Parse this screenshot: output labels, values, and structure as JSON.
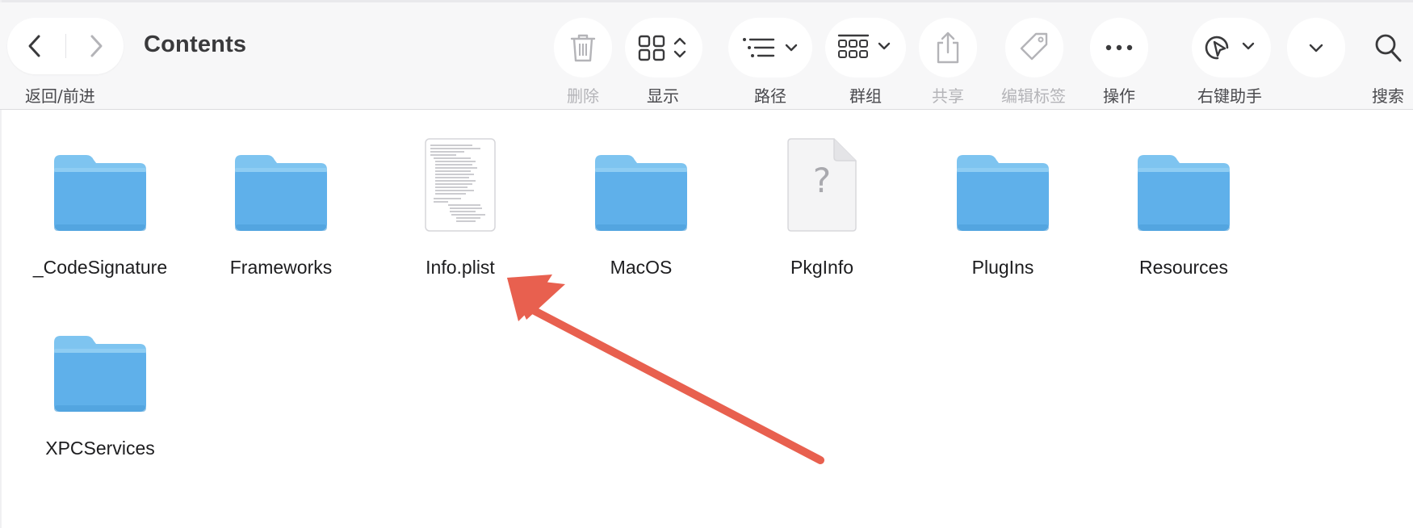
{
  "window": {
    "title": "Contents"
  },
  "toolbar": {
    "nav_caption": "返回/前进",
    "buttons": [
      {
        "label": "删除",
        "icon": "trash-icon",
        "disabled": true
      },
      {
        "label": "显示",
        "icon": "grid-view-icon",
        "disabled": false
      },
      {
        "label": "路径",
        "icon": "path-list-icon",
        "disabled": false
      },
      {
        "label": "群组",
        "icon": "group-icon",
        "disabled": false
      },
      {
        "label": "共享",
        "icon": "share-icon",
        "disabled": true
      },
      {
        "label": "编辑标签",
        "icon": "tag-icon",
        "disabled": true
      },
      {
        "label": "操作",
        "icon": "more-icon",
        "disabled": false
      },
      {
        "label": "右键助手",
        "icon": "cursor-assistant-icon",
        "disabled": false
      },
      {
        "label": "",
        "icon": "chevron-down-icon",
        "disabled": false
      },
      {
        "label": "搜索",
        "icon": "search-icon",
        "disabled": false
      }
    ]
  },
  "files": [
    {
      "name": "_CodeSignature",
      "kind": "folder"
    },
    {
      "name": "Frameworks",
      "kind": "folder"
    },
    {
      "name": "Info.plist",
      "kind": "plist-document"
    },
    {
      "name": "MacOS",
      "kind": "folder"
    },
    {
      "name": "PkgInfo",
      "kind": "unknown-document"
    },
    {
      "name": "PlugIns",
      "kind": "folder"
    },
    {
      "name": "Resources",
      "kind": "folder"
    },
    {
      "name": "XPCServices",
      "kind": "folder"
    }
  ],
  "annotation": {
    "type": "arrow",
    "color": "#e8604f",
    "points_to": "Info.plist"
  },
  "colors": {
    "folder_top": "#7ec4f0",
    "folder_body": "#5fb0ea",
    "toolbar_bg": "#f7f7f8",
    "window_bg": "#ffffff"
  }
}
